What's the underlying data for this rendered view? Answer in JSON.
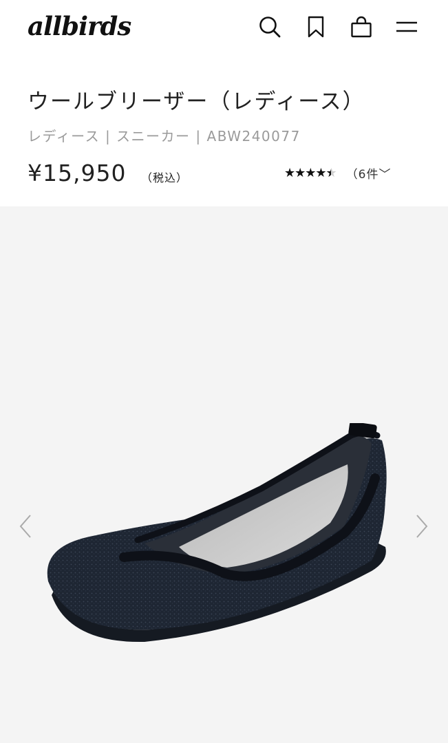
{
  "header": {
    "logo_text": "allbirds",
    "icons": [
      "search-icon",
      "bookmark-icon",
      "cart-icon",
      "menu-icon"
    ]
  },
  "product": {
    "title": "ウールブリーザー（レディース）",
    "subline": "レディース | スニーカー | ABW240077",
    "price": "¥15,950",
    "tax_note": "（税込）",
    "rating": {
      "value": 4.5,
      "max": 5,
      "stars_glyphs": "★★★★★",
      "count_label": "（6件",
      "chevron": "﹀"
    }
  },
  "gallery": {
    "prev_icon": "chevron-left-icon",
    "next_icon": "chevron-right-icon",
    "background_color": "#f4f4f4",
    "shoe_color": "#1e2633"
  }
}
